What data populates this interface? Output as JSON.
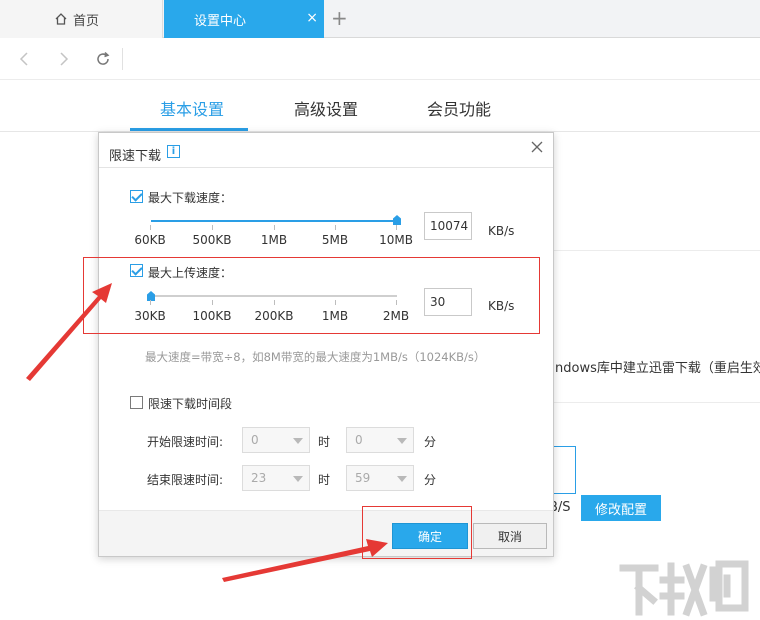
{
  "browser": {
    "home_tab_label": "首页",
    "active_tab_label": "设置中心",
    "close_glyph": "×",
    "new_tab_glyph": "+"
  },
  "settings": {
    "tabs": [
      {
        "label": "基本设置",
        "active": true
      },
      {
        "label": "高级设置",
        "active": false
      },
      {
        "label": "会员功能",
        "active": false
      }
    ],
    "bg_text_partial": "ndows库中建立迅雷下载（重启生效）",
    "bg_unit_partial": "B/S",
    "bg_modify_button": "修改配置"
  },
  "dialog": {
    "title": "限速下载",
    "info_glyph": "i",
    "max_download": {
      "checked": true,
      "label": "最大下载速度：",
      "scale": [
        "60KB",
        "500KB",
        "1MB",
        "5MB",
        "10MB"
      ],
      "slider_level": 1.0,
      "value": "10074",
      "unit": "KB/s"
    },
    "max_upload": {
      "checked": true,
      "label": "最大上传速度：",
      "scale": [
        "30KB",
        "100KB",
        "200KB",
        "1MB",
        "2MB"
      ],
      "slider_level": 0.0,
      "value": "30",
      "unit": "KB/s"
    },
    "note": "最大速度=带宽÷8，如8M带宽的最大速度为1MB/s（1024KB/s）",
    "time_limit": {
      "checked": false,
      "label": "限速下载时间段",
      "start_label": "开始限速时间:",
      "end_label": "结束限速时间:",
      "start_hour": "0",
      "start_minute": "0",
      "end_hour": "23",
      "end_minute": "59",
      "hour_unit": "时",
      "minute_unit": "分"
    },
    "ok_button": "确定",
    "cancel_button": "取消"
  },
  "colors": {
    "accent": "#29a8eb",
    "annotation_red": "#e53935"
  }
}
